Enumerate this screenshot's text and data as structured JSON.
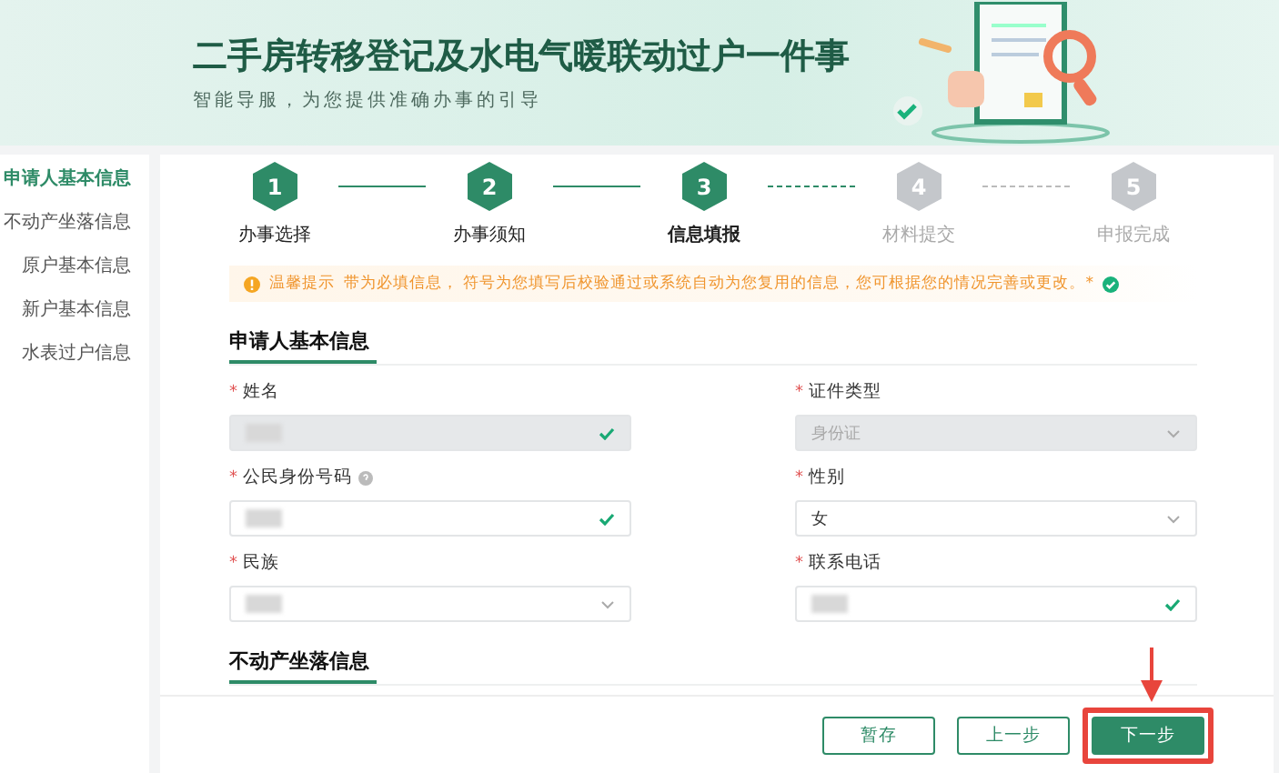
{
  "banner": {
    "title": "二手房转移登记及水电气暖联动过户一件事",
    "subtitle": "智能导服，为您提供准确办事的引导"
  },
  "sidebar": {
    "items": [
      {
        "label": "申请人基本信息",
        "selected": true
      },
      {
        "label": "不动产坐落信息",
        "selected": false
      },
      {
        "label": "原户基本信息",
        "selected": false
      },
      {
        "label": "新户基本信息",
        "selected": false
      },
      {
        "label": "水表过户信息",
        "selected": false
      }
    ]
  },
  "steps": [
    {
      "number": "1",
      "label": "办事选择",
      "selected": false
    },
    {
      "number": "2",
      "label": "办事须知",
      "selected": false
    },
    {
      "number": "3",
      "label": "信息填报",
      "selected": true
    },
    {
      "number": "4",
      "label": "材料提交",
      "selected": false
    },
    {
      "number": "5",
      "label": "申报完成",
      "selected": false
    }
  ],
  "notice": {
    "heading": "温馨提示",
    "text": "带为必填信息，  符号为您填写后校验通过或系统自动为您复用的信息，您可根据您的情况完善或更改。*"
  },
  "sections": [
    {
      "title": "申请人基本信息",
      "fields": [
        {
          "mark": "*",
          "label": "姓名",
          "disabled": true,
          "redacted": true,
          "help": false,
          "verified": true
        },
        {
          "mark": "*",
          "label": "证件类型",
          "disabled": true,
          "value": "身份证",
          "redacted": false,
          "help": false,
          "verified": false
        },
        {
          "mark": "*",
          "label": "公民身份号码",
          "disabled": false,
          "redacted": true,
          "help": true,
          "verified": true
        },
        {
          "mark": "*",
          "label": "性别",
          "disabled": false,
          "value": "女",
          "redacted": false,
          "help": false,
          "verified": false
        },
        {
          "mark": "*",
          "label": "民族",
          "disabled": false,
          "redacted": true,
          "help": false,
          "verified": false
        },
        {
          "mark": "*",
          "label": "联系电话",
          "disabled": false,
          "redacted": true,
          "help": false,
          "verified": true
        }
      ]
    },
    {
      "title": "不动产坐落信息"
    }
  ],
  "buttons": [
    {
      "label": "暂存",
      "kind": "secondary",
      "highlighted": false
    },
    {
      "label": "上一步",
      "kind": "secondary",
      "highlighted": false
    },
    {
      "label": "下一步",
      "kind": "primary",
      "highlighted": true
    }
  ]
}
